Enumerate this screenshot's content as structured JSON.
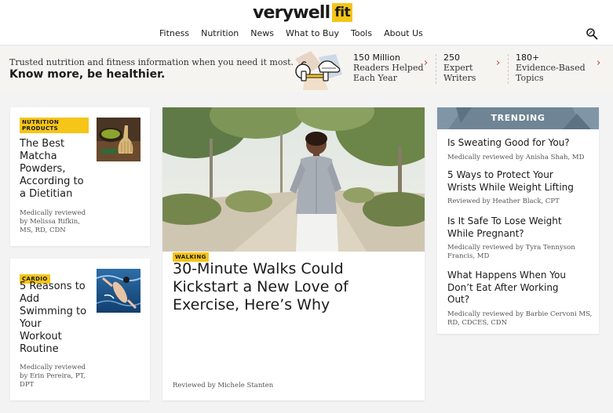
{
  "header": {
    "logo_word": "verywell",
    "logo_box": "fit",
    "nav": [
      "Fitness",
      "Nutrition",
      "News",
      "What to Buy",
      "Tools",
      "About Us"
    ],
    "search_icon": "search-icon"
  },
  "banner": {
    "tagline": "Trusted nutrition and fitness information when you need it most.",
    "headline": "Know more, be healthier.",
    "stats": [
      {
        "num": "150 Million",
        "label_1": "Readers Helped",
        "label_2": "Each Year"
      },
      {
        "num": "250",
        "label_1": "Expert",
        "label_2": "Writers"
      },
      {
        "num": "180+",
        "label_1": "Evidence-Based",
        "label_2": "Topics"
      }
    ],
    "arrow": "›"
  },
  "cards": {
    "matcha": {
      "tag": "NUTRITION PRODUCTS",
      "title_lines": [
        "The Best",
        "Matcha",
        "Powders,",
        "According to",
        "a Dietitian"
      ],
      "byline_lines": [
        "Medically reviewed",
        "by Melissa Rifkin,",
        "MS, RD, CDN"
      ]
    },
    "swimming": {
      "tag": "CARDIO",
      "title_lines": [
        "5 Reasons to",
        "Add",
        "Swimming to",
        "Your",
        "Workout",
        "Routine"
      ],
      "byline_lines": [
        "Medically reviewed",
        "by Erin Pereira, PT,",
        "DPT"
      ]
    },
    "feature": {
      "tag": "WALKING",
      "title": "30-Minute Walks Could Kickstart a New Love of Exercise, Here’s Why",
      "byline": "Reviewed by Michele Stanten"
    }
  },
  "trending": {
    "label": "TRENDING",
    "items": [
      {
        "title_lines": [
          "Is Sweating Good for You?"
        ],
        "by_lines": [
          "Medically reviewed by Anisha Shah, MD"
        ]
      },
      {
        "title_lines": [
          "5 Ways to Protect Your",
          "Wrists While Weight Lifting"
        ],
        "by_lines": [
          "Reviewed by Heather Black, CPT"
        ]
      },
      {
        "title_lines": [
          "Is It Safe To Lose Weight",
          "While Pregnant?"
        ],
        "by_lines": [
          "Medically reviewed by Tyra Tennyson",
          "Francis, MD"
        ]
      },
      {
        "title_lines": [
          "What Happens When You",
          "Don’t Eat After Working",
          "Out?"
        ],
        "by_lines": [
          "Medically reviewed by Barbie Cervoni MS,",
          "RD, CDCES, CDN"
        ]
      }
    ]
  },
  "colors": {
    "accent": "#f5c518",
    "trending": "#6f8494",
    "arrow": "#c0392b"
  }
}
